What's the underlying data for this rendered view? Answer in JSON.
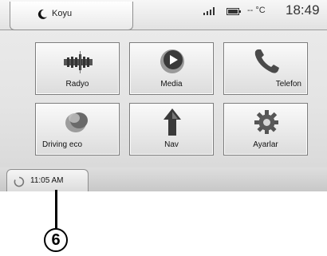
{
  "header": {
    "profile_label": "Koyu",
    "temperature": "-- °C",
    "clock": "18:49",
    "icons": [
      "moon-icon",
      "signal-icon",
      "battery-icon"
    ]
  },
  "menu": {
    "tiles": [
      {
        "label": "Radyo",
        "icon": "radio-icon"
      },
      {
        "label": "Media",
        "icon": "play-icon"
      },
      {
        "label": "Telefon",
        "icon": "phone-icon"
      },
      {
        "label": "Driving eco",
        "icon": "eco-leaf-icon"
      },
      {
        "label": "Nav",
        "icon": "navigation-arrow-icon"
      },
      {
        "label": "Ayarlar",
        "icon": "gear-icon"
      }
    ]
  },
  "footer": {
    "time_label": "11:05 AM",
    "icon": "loading-icon"
  },
  "callout": {
    "number": "6"
  }
}
